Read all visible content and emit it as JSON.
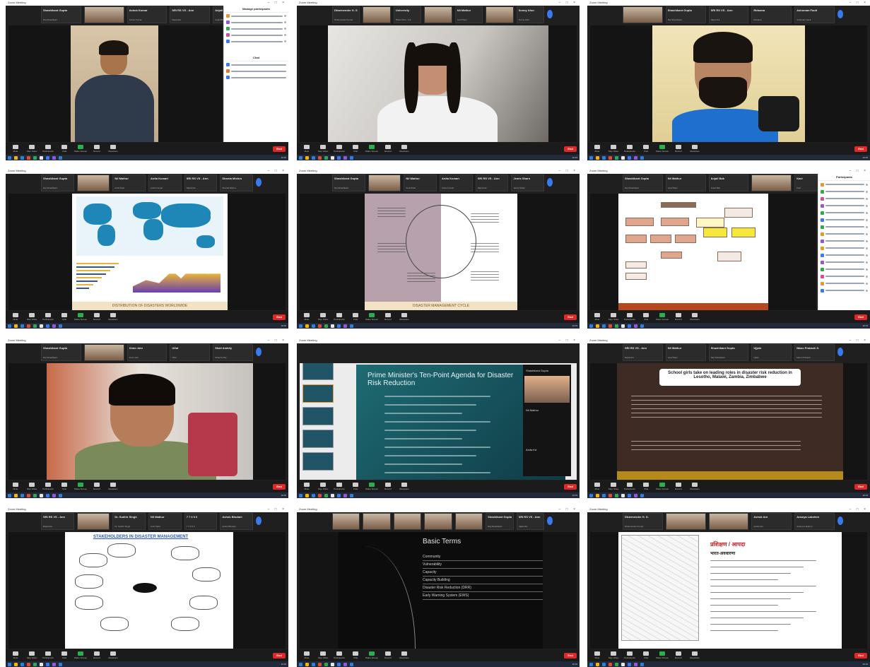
{
  "tiles": [
    {
      "participants": [
        "Shashikant Gupta",
        "",
        "Ashok Kumar",
        "SRI RS VS - Ann",
        "Anjali Bhatnagar"
      ],
      "participants_sub": [
        "Raj Shashikant",
        "",
        "Ashok Kumar",
        "Rajvindra",
        "Anjali Bhatnagar"
      ],
      "panel_title": "Manage participants",
      "panel_chat_title": "Chat",
      "toolbar": [
        "Mute",
        "Stop Video",
        "Participants",
        "Chat",
        "Share Screen",
        "Record",
        "Reactions"
      ],
      "end_label": "End"
    },
    {
      "participants": [
        "Dharmender G. S.",
        "",
        "University",
        "",
        "Nil Mathur",
        "",
        "Sunny Ahur"
      ],
      "participants_sub": [
        "Dharmender Kumar",
        "",
        "Bharti MLA - bxc",
        "",
        "Amit Patel",
        "",
        "Sunny Ahur"
      ],
      "toolbar": [
        "Mute",
        "Stop Video",
        "Participants",
        "Chat",
        "Share Screen",
        "Record",
        "Reactions"
      ],
      "end_label": "End"
    },
    {
      "participants": [
        "",
        "Shashikant Gupta",
        "SRI RS VS - Ann",
        "Riduana",
        "Ashuman Fault"
      ],
      "participants_sub": [
        "",
        "Raj Shashikant",
        "Rajvindra",
        "Riduana",
        "Ashuman Fault"
      ],
      "toolbar": [
        "Mute",
        "Stop Video",
        "Participants",
        "Chat",
        "Share Screen",
        "Record",
        "Reactions"
      ],
      "end_label": "End"
    },
    {
      "participants": [
        "Shashikant Gupta",
        "",
        "Nil Mathur",
        "Anita Kumari",
        "SRI RS VS - Ann",
        "Sharda Mishra"
      ],
      "participants_sub": [
        "Raj Shashikant",
        "",
        "Amit Patel",
        "Anita Kumari",
        "Rajvindra",
        "Sharda Mishra"
      ],
      "slide_caption": "DISTRIBUTION OF DISASTERS WORLDWIDE",
      "toolbar": [
        "Mute",
        "Stop Video",
        "Participants",
        "Chat",
        "Share Screen",
        "Record",
        "Reactions"
      ],
      "end_label": "End"
    },
    {
      "participants": [
        "Shashikant Gupta",
        "",
        "Nil Mathur",
        "Anita Kumari",
        "SRI RS VS - Ann",
        "Jemis Sharn"
      ],
      "participants_sub": [
        "Raj Shashikant",
        "",
        "Amit Patel",
        "Anita Kumari",
        "Rajvindra",
        "Jemis Sharn"
      ],
      "slide_caption": "DISASTER MANAGEMENT CYCLE",
      "toolbar": [
        "Mute",
        "Stop Video",
        "Participants",
        "Chat",
        "Share Screen",
        "Record",
        "Reactions"
      ],
      "end_label": "End"
    },
    {
      "participants": [
        "Shashikant Gupta",
        "Nil Mathur",
        "Anjali Bak",
        "",
        "Kavi"
      ],
      "participants_sub": [
        "Raj Shashikant",
        "Amit Patel",
        "Anjali Bak",
        "",
        "Kavi"
      ],
      "panel_title": "Participants",
      "toolbar": [
        "Mute",
        "Stop Video",
        "Participants",
        "Chat",
        "Share Screen",
        "Record",
        "Reactions"
      ],
      "end_label": "End"
    },
    {
      "participants": [
        "Shashikant Gupta",
        "",
        "Kiran Jain",
        "Ulfat",
        "Shail Ambily"
      ],
      "participants_sub": [
        "Raj Shashikant",
        "",
        "Kiran Jain",
        "Ulfat",
        "Shail Ambily"
      ],
      "toolbar": [
        "Mute",
        "Stop Video",
        "Participants",
        "Chat",
        "Share Screen",
        "Record",
        "Reactions"
      ],
      "end_label": "End"
    },
    {
      "slide_title": "Prime Minister's Ten-Point Agenda for Disaster Risk Reduction",
      "side_names": [
        "Shashikant Gupta",
        "Nil Mathur",
        "Anita Kd"
      ],
      "toolbar": [
        "Mute",
        "Stop Video",
        "Participants",
        "Chat",
        "Share Screen",
        "Record",
        "Reactions"
      ],
      "end_label": "End"
    },
    {
      "participants": [
        "SRI RS VS - Ann",
        "Nil Mathur",
        "Shashikant Gupta",
        "Ujjain",
        "Manu Prakash S."
      ],
      "participants_sub": [
        "Rajvindra",
        "Amit Patel",
        "Raj Shashikant",
        "Ujjain",
        "Manu Prakash"
      ],
      "slide_title": "School girls take on leading roles in disaster risk reduction in Lesotho, Malawi, Zambia, Zimbabwe",
      "toolbar": [
        "Mute",
        "Stop Video",
        "Participants",
        "Chat",
        "Share Screen",
        "Record",
        "Reactions"
      ],
      "end_label": "End"
    },
    {
      "participants": [
        "SRI RS VS - Ann",
        "",
        "Dr. Sudhir Singh",
        "Nil Mathur",
        "7 7 0 6 0",
        "Ashok Bhutani"
      ],
      "participants_sub": [
        "Rajvindra",
        "",
        "Dr. Sudhir Singh",
        "Amit Patel",
        "7 7 0 6 0",
        "Ashok Bhutani"
      ],
      "slide_title": "STAKEHOLDERS IN DISASTER MANAGEMENT",
      "toolbar": [
        "Mute",
        "Stop Video",
        "Participants",
        "Chat",
        "Share Screen",
        "Record",
        "Reactions"
      ],
      "end_label": "End"
    },
    {
      "participants": [
        "",
        "",
        "",
        "",
        "",
        "Shashikant Gupta",
        "SRI RS VS - Ann"
      ],
      "participants_sub": [
        "",
        "",
        "",
        "",
        "",
        "Raj Shashikant",
        "Rajvindra"
      ],
      "slide_title": "Basic Terms",
      "terms": [
        "Community",
        "Vulnerability",
        "Capacity",
        "Capacity Building",
        "Disaster Risk Reduction (DRR)",
        "Early Warning System (EWS)"
      ],
      "toolbar": [
        "Mute",
        "Stop Video",
        "Participants",
        "Chat",
        "Share Screen",
        "Record",
        "Reactions"
      ],
      "end_label": "End"
    },
    {
      "participants": [
        "Dharmender G. S.",
        "",
        "",
        "Ashok Ani",
        "Ananya Lakshmi"
      ],
      "participants_sub": [
        "Dharmender Kumar",
        "",
        "",
        "Ashok Ani",
        "Ananya Lakshmi"
      ],
      "slide_title": "प्रशिक्षण / आपदा",
      "slide_subtitle": "भारत-अवधारणा",
      "toolbar": [
        "Mute",
        "Stop Video",
        "Participants",
        "Chat",
        "Share Screen",
        "Record",
        "Reactions"
      ],
      "end_label": "End"
    }
  ],
  "window_title": "Zoom Meeting",
  "clock": "10:15"
}
